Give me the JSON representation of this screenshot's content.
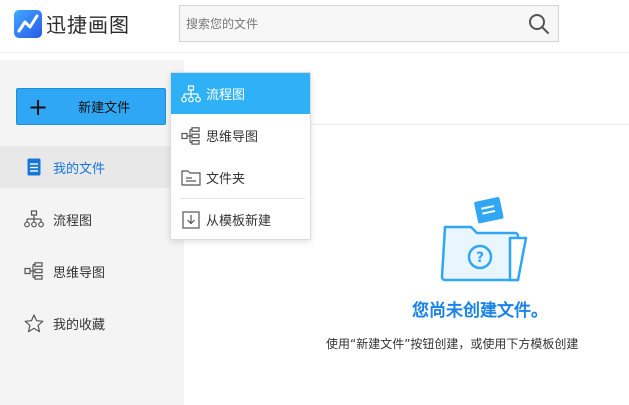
{
  "app": {
    "name": "迅捷画图",
    "logo_icon": "app-logo-icon"
  },
  "search": {
    "placeholder": "搜索您的文件",
    "icon": "search-icon"
  },
  "sidebar": {
    "new_button": {
      "label": "新建文件",
      "icon": "plus-icon"
    },
    "items": [
      {
        "label": "我的文件",
        "icon": "document-icon",
        "active": true
      },
      {
        "label": "流程图",
        "icon": "flowchart-icon",
        "active": false
      },
      {
        "label": "思维导图",
        "icon": "mindmap-icon",
        "active": false
      },
      {
        "label": "我的收藏",
        "icon": "star-icon",
        "active": false
      }
    ]
  },
  "new_menu": {
    "items": [
      {
        "label": "流程图",
        "icon": "flowchart-icon",
        "active": true
      },
      {
        "label": "思维导图",
        "icon": "mindmap-icon",
        "active": false
      },
      {
        "label": "文件夹",
        "icon": "folder-icon",
        "active": false
      },
      {
        "label": "从模板新建",
        "icon": "template-import-icon",
        "active": false
      }
    ]
  },
  "empty_state": {
    "title": "您尚未创建文件。",
    "description": "使用“新建文件”按钮创建，或使用下方模板创建",
    "icon": "empty-folder-icon"
  },
  "colors": {
    "accent": "#2fa7f5",
    "menu_active": "#2fb1f7",
    "title_blue": "#1b83e6",
    "sidebar_bg": "#f4f4f4"
  }
}
